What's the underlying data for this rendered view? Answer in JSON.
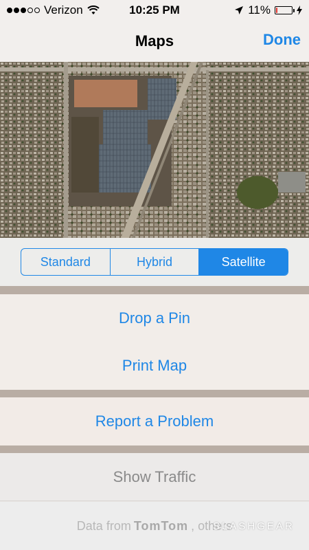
{
  "status_bar": {
    "carrier": "Verizon",
    "time": "10:25 PM",
    "battery_text": "11%",
    "battery_level": 0.11,
    "signal_bars_filled": 3,
    "signal_bars_total": 5
  },
  "nav": {
    "title": "Maps",
    "done_label": "Done"
  },
  "map_types": {
    "options": [
      "Standard",
      "Hybrid",
      "Satellite"
    ],
    "selected": "Satellite"
  },
  "actions": {
    "drop_pin": "Drop a Pin",
    "print_map": "Print Map",
    "report_problem": "Report a Problem",
    "show_traffic": "Show Traffic"
  },
  "footer": {
    "data_from": "Data from",
    "brand": "TomTom",
    "others": ", others"
  },
  "watermark": "SLASHGEAR",
  "colors": {
    "accent": "#1f87e6",
    "battery_low": "#e3342f"
  }
}
